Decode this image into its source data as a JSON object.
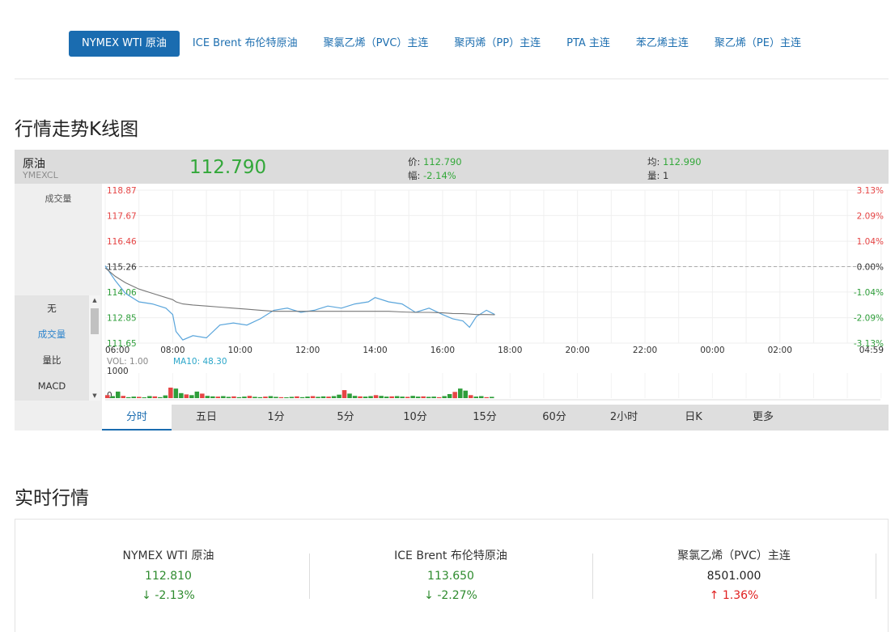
{
  "topnav": {
    "tabs": [
      {
        "label": "NYMEX WTI 原油",
        "active": true
      },
      {
        "label": "ICE Brent 布伦特原油",
        "active": false
      },
      {
        "label": "聚氯乙烯（PVC）主连",
        "active": false
      },
      {
        "label": "聚丙烯（PP）主连",
        "active": false
      },
      {
        "label": "PTA 主连",
        "active": false
      },
      {
        "label": "苯乙烯主连",
        "active": false
      },
      {
        "label": "聚乙烯（PE）主连",
        "active": false
      }
    ]
  },
  "kline": {
    "section_title": "行情走势K线图",
    "header": {
      "name": "原油",
      "code": "YMEXCL",
      "price": "112.790",
      "price_label": "价:",
      "price_value": "112.790",
      "range_label": "幅:",
      "range_value": "-2.14%",
      "avg_label": "均:",
      "avg_value": "112.990",
      "volume_label": "量:",
      "volume_value": "1"
    },
    "side": {
      "volume_label": "成交量",
      "indicators": [
        "无",
        "成交量",
        "量比",
        "MACD"
      ],
      "selected_indicator": "成交量"
    },
    "periods": [
      "分时",
      "五日",
      "1分",
      "5分",
      "10分",
      "15分",
      "60分",
      "2小时",
      "日K",
      "更多"
    ],
    "active_period": "分时"
  },
  "chart_data": {
    "type": "line",
    "y_left_ticks": [
      "118.87",
      "117.67",
      "116.46",
      "115.26",
      "114.06",
      "112.85",
      "111.65"
    ],
    "y_right_ticks": [
      "3.13%",
      "2.09%",
      "1.04%",
      "0.00%",
      "-1.04%",
      "-2.09%",
      "-3.13%"
    ],
    "x_ticks": [
      "06:00",
      "08:00",
      "10:00",
      "12:00",
      "14:00",
      "16:00",
      "18:00",
      "20:00",
      "22:00",
      "00:00",
      "02:00",
      "04:59"
    ],
    "ylim": [
      111.65,
      118.87
    ],
    "reference_price": 115.26,
    "x_hours": [
      6,
      6.3,
      6.6,
      7,
      7.4,
      7.8,
      8,
      8.1,
      8.3,
      8.6,
      9,
      9.4,
      9.8,
      10.2,
      10.6,
      11,
      11.4,
      11.8,
      12.2,
      12.6,
      13,
      13.4,
      13.8,
      14,
      14.4,
      14.8,
      15.2,
      15.6,
      16,
      16.3,
      16.6,
      16.8,
      17,
      17.3,
      17.55
    ],
    "price_series": [
      {
        "name": "price",
        "color": "#5aa5db",
        "values": [
          115.3,
          114.6,
          114.0,
          113.6,
          113.5,
          113.3,
          113.0,
          112.2,
          111.8,
          112.0,
          111.9,
          112.5,
          112.6,
          112.5,
          112.8,
          113.2,
          113.3,
          113.1,
          113.2,
          113.4,
          113.3,
          113.5,
          113.6,
          113.8,
          113.6,
          113.5,
          113.1,
          113.3,
          113.0,
          112.8,
          112.7,
          112.4,
          112.9,
          113.2,
          113.0
        ]
      },
      {
        "name": "average",
        "color": "#777777",
        "values": [
          115.2,
          114.8,
          114.5,
          114.2,
          114.0,
          113.8,
          113.7,
          113.6,
          113.5,
          113.45,
          113.4,
          113.35,
          113.3,
          113.25,
          113.2,
          113.15,
          113.15,
          113.15,
          113.15,
          113.15,
          113.15,
          113.15,
          113.15,
          113.15,
          113.15,
          113.12,
          113.1,
          113.1,
          113.08,
          113.05,
          113.04,
          113.02,
          113.0,
          113.0,
          112.99
        ]
      }
    ],
    "volume": {
      "label_vol": "VOL: 1.00",
      "label_ma": "MA10: 48.30",
      "ticks": [
        "1000",
        "0"
      ],
      "ylim": [
        0,
        1000
      ],
      "bars": [
        120,
        80,
        260,
        90,
        40,
        60,
        50,
        30,
        80,
        70,
        40,
        110,
        420,
        380,
        200,
        150,
        120,
        260,
        180,
        90,
        70,
        60,
        80,
        50,
        70,
        40,
        60,
        90,
        50,
        40,
        60,
        80,
        50,
        40,
        30,
        50,
        70,
        40,
        60,
        80,
        50,
        70,
        60,
        80,
        140,
        320,
        180,
        90,
        70,
        60,
        80,
        120,
        90,
        60,
        70,
        80,
        60,
        50,
        90,
        60,
        70,
        50,
        60,
        40,
        80,
        160,
        250,
        380,
        300,
        120,
        60,
        80,
        40,
        50
      ]
    }
  },
  "realtime": {
    "section_title": "实时行情",
    "items": [
      {
        "name": "NYMEX WTI 原油",
        "price": "112.810",
        "change": "↓ -2.13%",
        "direction": "down"
      },
      {
        "name": "ICE Brent 布伦特原油",
        "price": "113.650",
        "change": "↓ -2.27%",
        "direction": "down"
      },
      {
        "name": "聚氯乙烯（PVC）主连",
        "price": "8501.000",
        "change": "↑ 1.36%",
        "direction": "up"
      }
    ]
  },
  "colors": {
    "accent": "#1a6cb0",
    "up": "#e02020",
    "down": "#2e8b2e",
    "price_line": "#5aa5db"
  }
}
